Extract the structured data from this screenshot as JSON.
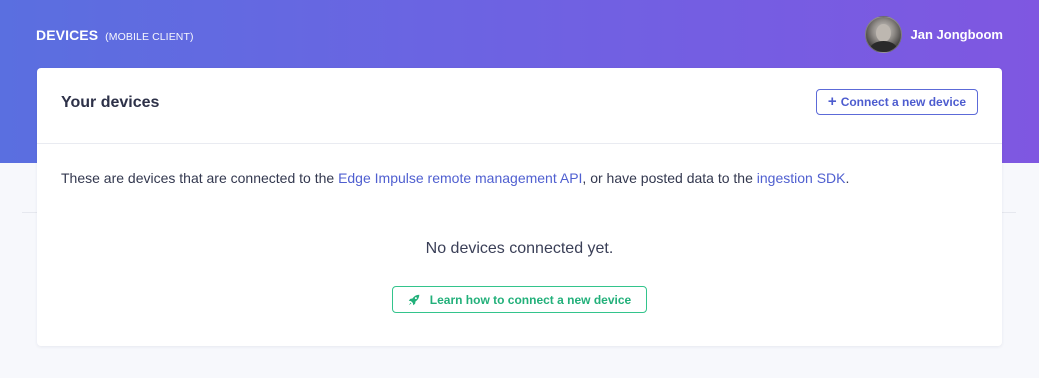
{
  "header": {
    "title": "DEVICES",
    "subtitle": "(MOBILE CLIENT)",
    "user_name": "Jan Jongboom"
  },
  "card": {
    "title": "Your devices",
    "connect_button": "Connect a new device",
    "description": {
      "prefix": "These are devices that are connected to the ",
      "link1": "Edge Impulse remote management API",
      "middle": ", or have posted data to the ",
      "link2": "ingestion SDK",
      "suffix": "."
    },
    "empty_text": "No devices connected yet.",
    "learn_button": "Learn how to connect a new device"
  },
  "colors": {
    "gradient_start": "#5a6fe0",
    "gradient_end": "#7f57e1",
    "link": "#4f5fd0",
    "accent_green": "#22b07a"
  },
  "icons": [
    "plus-icon",
    "rocket-icon",
    "avatar"
  ]
}
